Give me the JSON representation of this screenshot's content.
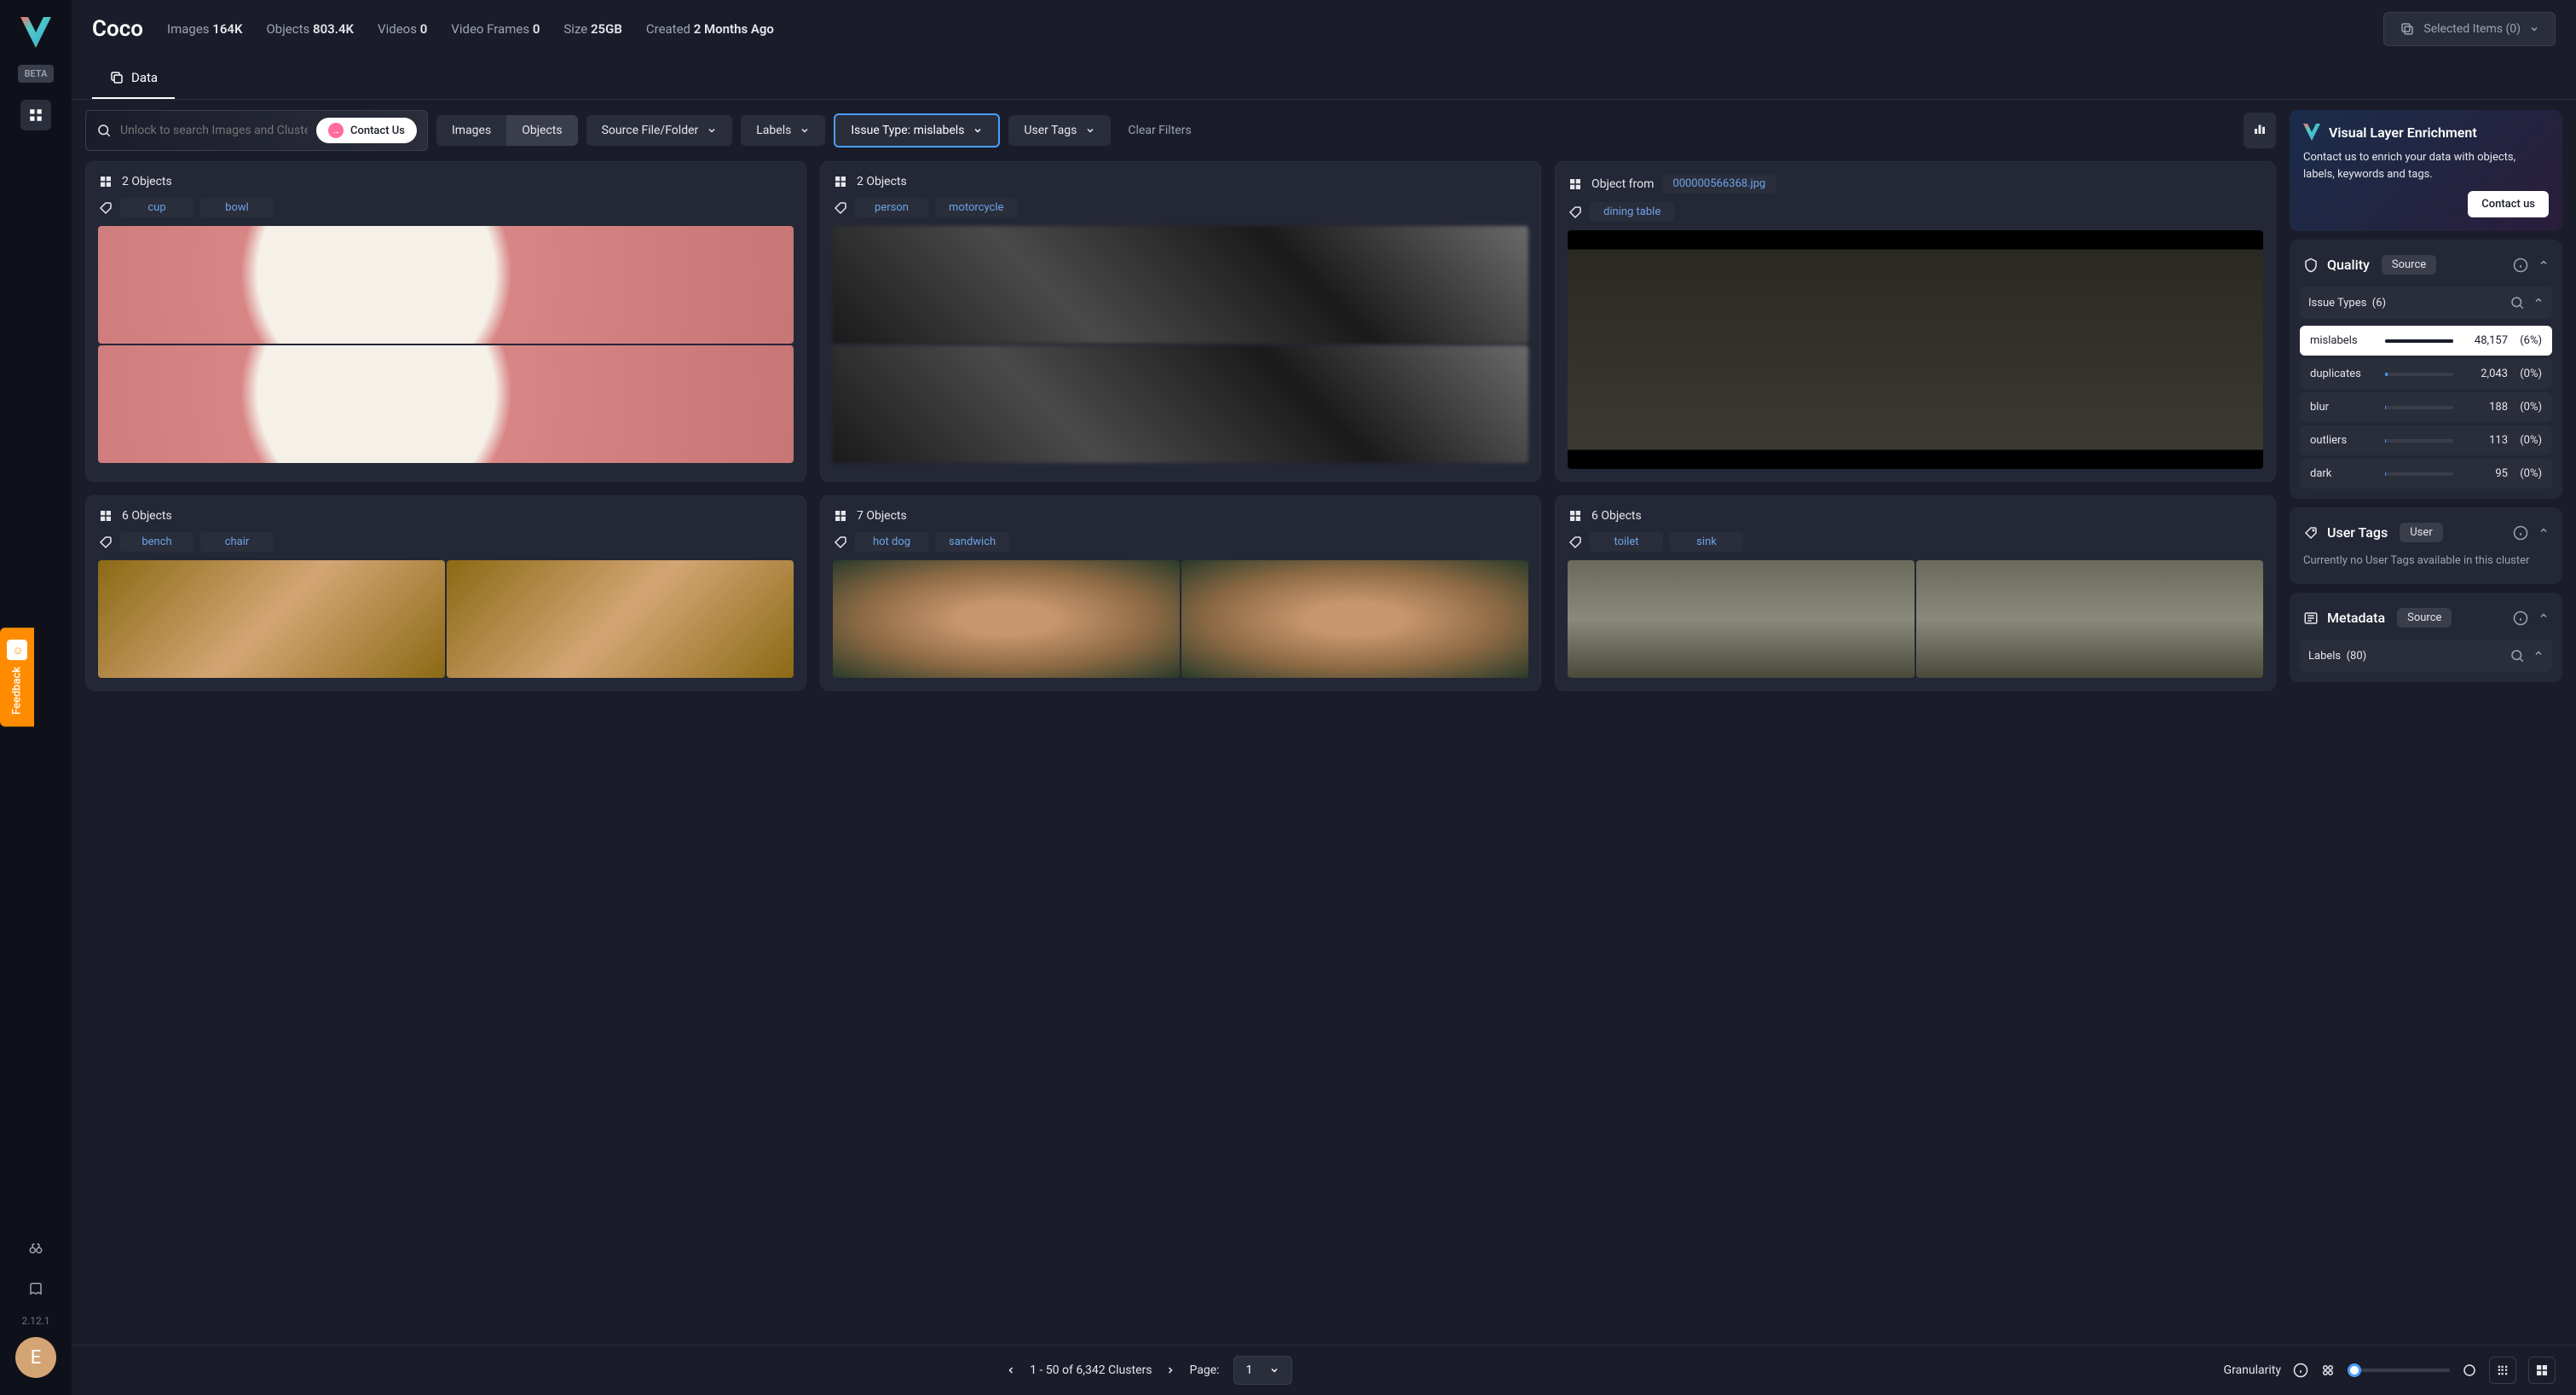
{
  "sidebar": {
    "beta": "BETA",
    "version": "2.12.1",
    "avatar_initial": "E",
    "feedback": "Feedback"
  },
  "header": {
    "title": "Coco",
    "stats": {
      "images_label": "Images",
      "images_value": "164K",
      "objects_label": "Objects",
      "objects_value": "803.4K",
      "videos_label": "Videos",
      "videos_value": "0",
      "frames_label": "Video Frames",
      "frames_value": "0",
      "size_label": "Size",
      "size_value": "25GB",
      "created_label": "Created",
      "created_value": "2 Months Ago"
    },
    "selected_items": "Selected Items (0)"
  },
  "tabs": {
    "data": "Data"
  },
  "filters": {
    "search_placeholder": "Unlock to search Images and Clusters",
    "contact_us": "Contact Us",
    "images": "Images",
    "objects": "Objects",
    "source": "Source File/Folder",
    "labels": "Labels",
    "issue_type": "Issue Type: mislabels",
    "user_tags": "User Tags",
    "clear": "Clear Filters"
  },
  "cards": [
    {
      "header": "2 Objects",
      "tags": [
        "cup",
        "bowl"
      ],
      "img_class": "cups",
      "layout": "col2"
    },
    {
      "header": "2 Objects",
      "tags": [
        "person",
        "motorcycle"
      ],
      "img_class": "motor",
      "layout": "col2"
    },
    {
      "header_prefix": "Object from",
      "source": "000000566368.jpg",
      "tags": [
        "dining table"
      ],
      "img_class": "table",
      "layout": "single"
    },
    {
      "header": "6 Objects",
      "tags": [
        "bench",
        "chair"
      ],
      "img_class": "bench",
      "layout": "row2"
    },
    {
      "header": "7 Objects",
      "tags": [
        "hot dog",
        "sandwich"
      ],
      "img_class": "bread",
      "layout": "row2"
    },
    {
      "header": "6 Objects",
      "tags": [
        "toilet",
        "sink"
      ],
      "img_class": "toilet",
      "layout": "row2"
    }
  ],
  "right_panel": {
    "enrichment": {
      "title": "Visual Layer Enrichment",
      "text": "Contact us to enrich your data with objects, labels, keywords and tags.",
      "button": "Contact us"
    },
    "quality": {
      "title": "Quality",
      "pill": "Source",
      "issue_types_label": "Issue Types",
      "issue_types_count": "(6)",
      "issues": [
        {
          "name": "mislabels",
          "count": "48,157",
          "pct": "(6%)",
          "fill": 100,
          "selected": true
        },
        {
          "name": "duplicates",
          "count": "2,043",
          "pct": "(0%)",
          "fill": 4,
          "selected": false
        },
        {
          "name": "blur",
          "count": "188",
          "pct": "(0%)",
          "fill": 1,
          "selected": false
        },
        {
          "name": "outliers",
          "count": "113",
          "pct": "(0%)",
          "fill": 1,
          "selected": false
        },
        {
          "name": "dark",
          "count": "95",
          "pct": "(0%)",
          "fill": 1,
          "selected": false
        }
      ]
    },
    "user_tags": {
      "title": "User Tags",
      "pill": "User",
      "empty": "Currently no User Tags available in this cluster"
    },
    "metadata": {
      "title": "Metadata",
      "pill": "Source",
      "labels_label": "Labels",
      "labels_count": "(80)"
    }
  },
  "footer": {
    "range": "1 - 50 of 6,342 Clusters",
    "page_label": "Page:",
    "page_value": "1",
    "granularity": "Granularity"
  }
}
